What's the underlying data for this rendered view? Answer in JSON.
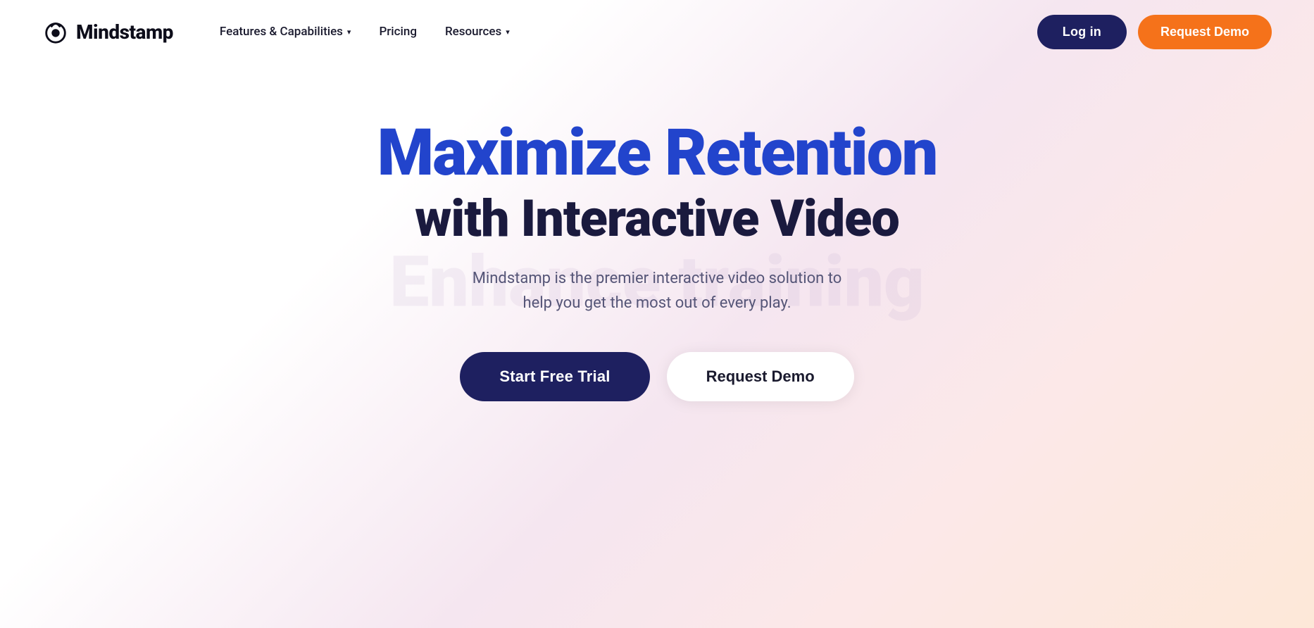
{
  "logo": {
    "text": "Mindstamp"
  },
  "nav": {
    "features_label": "Features & Capabilities",
    "pricing_label": "Pricing",
    "resources_label": "Resources",
    "login_label": "Log in",
    "request_demo_label": "Request Demo"
  },
  "hero": {
    "title_line1": "Maximize Retention",
    "title_line2": "with Interactive Video",
    "description_line1": "Mindstamp is the premier interactive video solution to",
    "description_line2": "help you get the most out of every play.",
    "btn_trial": "Start Free Trial",
    "btn_demo": "Request Demo"
  },
  "bg": {
    "watermark": "Enhance training"
  }
}
